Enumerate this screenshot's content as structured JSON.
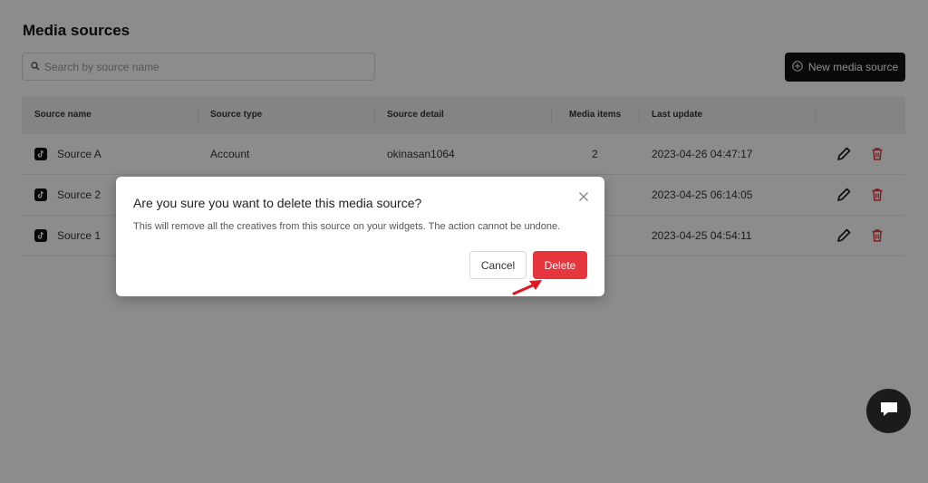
{
  "page": {
    "title": "Media sources"
  },
  "search": {
    "placeholder": "Search by source name"
  },
  "new_button": {
    "label": "New media source"
  },
  "table": {
    "headers": [
      "Source name",
      "Source type",
      "Source detail",
      "Media items",
      "Last update"
    ],
    "rows": [
      {
        "name": "Source A",
        "type": "Account",
        "detail": "okinasan1064",
        "items": "2",
        "updated": "2023-04-26 04:47:17"
      },
      {
        "name": "Source 2",
        "type": "",
        "detail": "",
        "items": "",
        "updated": "2023-04-25 06:14:05"
      },
      {
        "name": "Source 1",
        "type": "",
        "detail": "",
        "items": "",
        "updated": "2023-04-25 04:54:11"
      }
    ]
  },
  "modal": {
    "title": "Are you sure you want to delete this media source?",
    "body": "This will remove all the creatives from this source on your widgets. The action cannot be undone.",
    "cancel_label": "Cancel",
    "delete_label": "Delete"
  },
  "icons": {
    "search": "search-icon",
    "add": "plus-circle-icon",
    "source": "tiktok-icon",
    "edit": "pencil-icon",
    "delete": "trash-icon",
    "close": "close-icon",
    "chat": "chat-icon",
    "annotation": "red-arrow-icon"
  },
  "colors": {
    "primary_dark": "#111111",
    "danger": "#e5363d",
    "overlay": "rgba(0,0,0,0.45)",
    "annotation": "#e0161e"
  }
}
